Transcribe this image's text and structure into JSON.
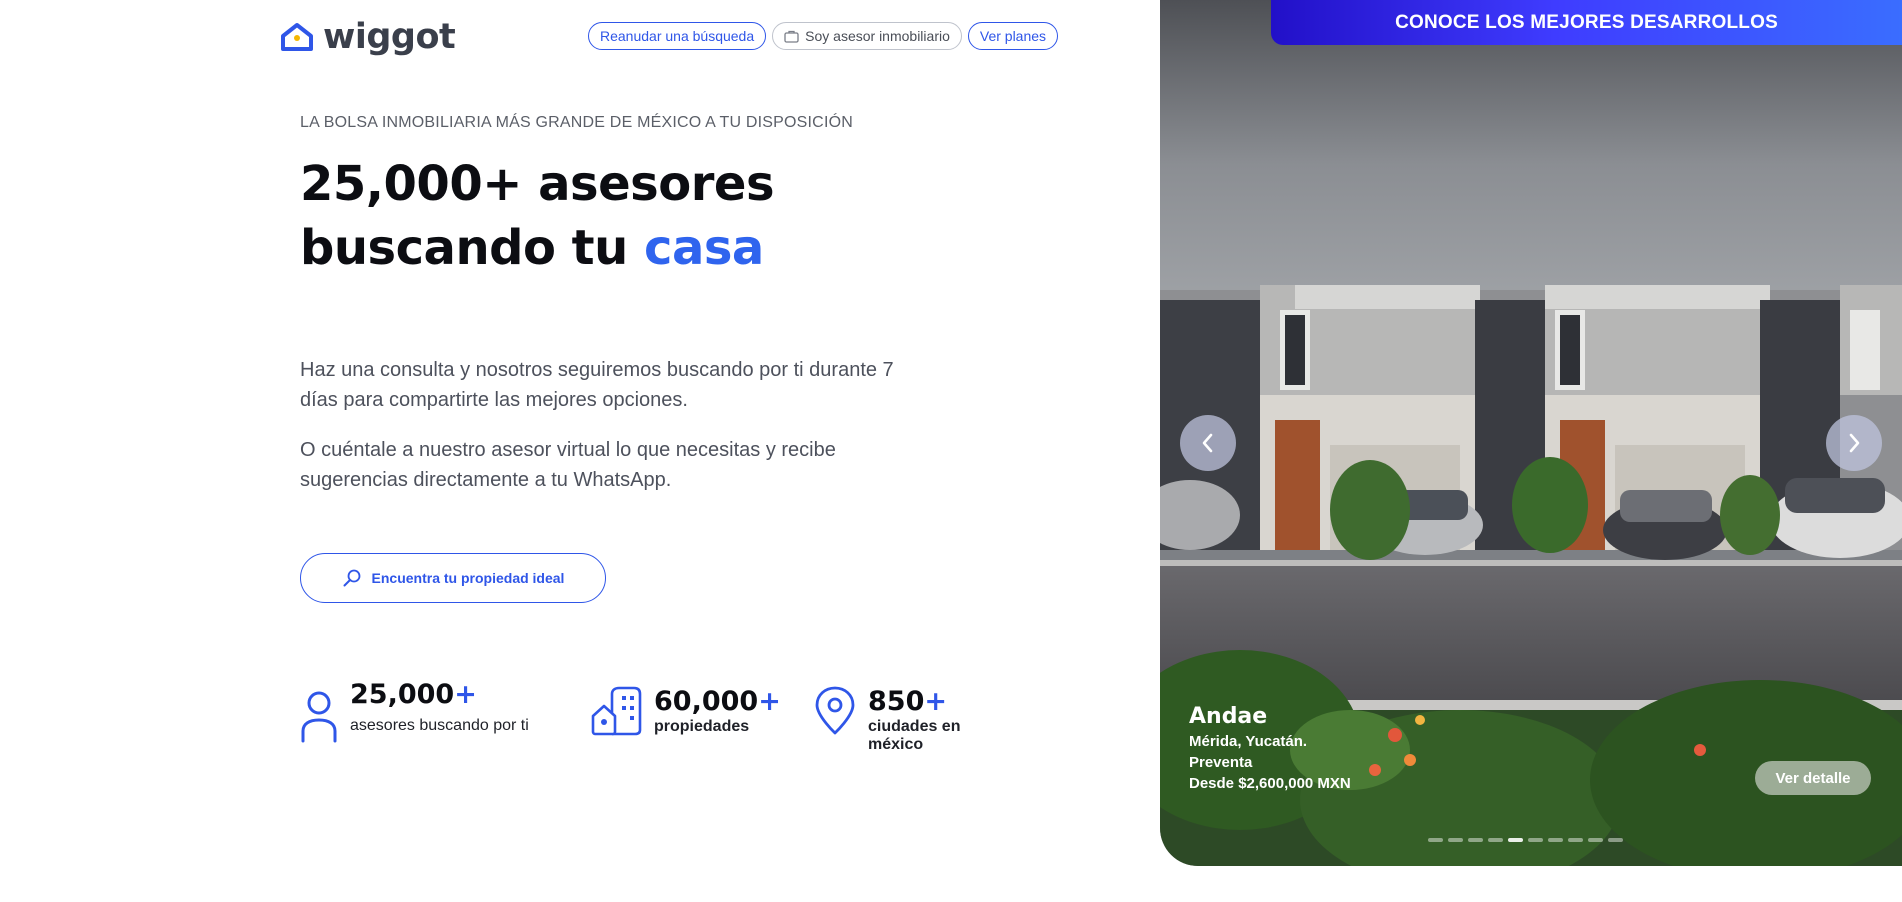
{
  "brand": {
    "name": "wiggot",
    "color": "#2f56e8"
  },
  "nav": {
    "resume_search": "Reanudar una búsqueda",
    "agent": "Soy asesor inmobiliario",
    "plans": "Ver planes"
  },
  "hero_text": {
    "tagline": "LA BOLSA INMOBILIARIA MÁS GRANDE DE MÉXICO A TU DISPOSICIÓN",
    "headline_1": "25,000+ asesores",
    "headline_2": "buscando tu",
    "headline_accent": "casa",
    "paragraph_1": "Haz una consulta y nosotros seguiremos buscando por ti durante 7 días para compartirte las mejores opciones.",
    "paragraph_2": "O cuéntale a nuestro asesor virtual lo que necesitas y recibe sugerencias directamente a tu WhatsApp.",
    "cta_label": "Encuentra tu propiedad ideal"
  },
  "stats": [
    {
      "value": "25,000",
      "plus": "+",
      "label": "asesores buscando por ti",
      "icon": "person-icon"
    },
    {
      "value": "60,000",
      "plus": "+",
      "label": "propiedades",
      "icon": "building-icon"
    },
    {
      "value": "850",
      "plus": "+",
      "label": "ciudades en méxico",
      "icon": "location-pin-icon"
    }
  ],
  "carousel": {
    "banner": "CONOCE LOS MEJORES DESARROLLOS",
    "property": {
      "name": "Andae",
      "location": "Mérida, Yucatán.",
      "stage": "Preventa",
      "price": "Desde $2,600,000 MXN"
    },
    "detail_button": "Ver detalle",
    "slide_count": 10,
    "active_slide": 4
  }
}
